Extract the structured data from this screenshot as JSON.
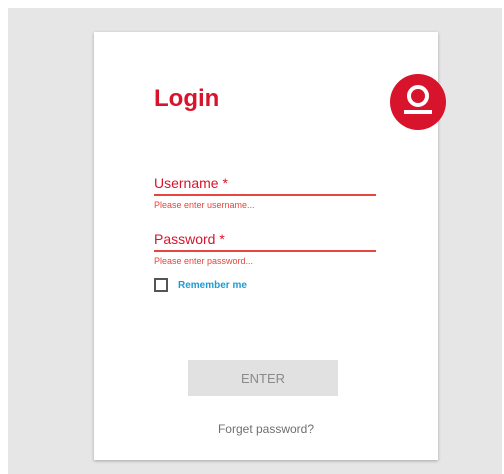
{
  "login": {
    "title": "Login",
    "brand_icon": "user-circle-icon",
    "colors": {
      "accent": "#d7142b",
      "error": "#e5453c",
      "link": "#1f9bd1"
    },
    "username": {
      "label": "Username *",
      "error": "Please enter username..."
    },
    "password": {
      "label": "Password *",
      "error": "Please enter password..."
    },
    "remember": {
      "label": "Remember me",
      "checked": false
    },
    "enter_label": "ENTER",
    "forgot_label": "Forget password?"
  }
}
